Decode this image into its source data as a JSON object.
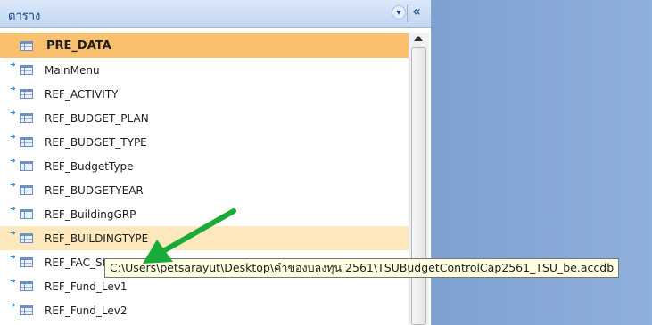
{
  "panel": {
    "title": "ตาราง",
    "dropdown_icon": "chevron-down-icon",
    "collapse_label": "«"
  },
  "tables": [
    {
      "name": "PRE_DATA",
      "state": "selected"
    },
    {
      "name": "MainMenu",
      "state": "normal"
    },
    {
      "name": "REF_ACTIVITY",
      "state": "normal"
    },
    {
      "name": "REF_BUDGET_PLAN",
      "state": "normal"
    },
    {
      "name": "REF_BUDGET_TYPE",
      "state": "normal"
    },
    {
      "name": "REF_BudgetType",
      "state": "normal"
    },
    {
      "name": "REF_BUDGETYEAR",
      "state": "normal"
    },
    {
      "name": "REF_BuildingGRP",
      "state": "normal"
    },
    {
      "name": "REF_BUILDINGTYPE",
      "state": "hover"
    },
    {
      "name": "REF_FAC_St",
      "state": "normal"
    },
    {
      "name": "REF_Fund_Lev1",
      "state": "normal"
    },
    {
      "name": "REF_Fund_Lev2",
      "state": "normal"
    }
  ],
  "tooltip": {
    "text": "C:\\Users\\petsarayut\\Desktop\\คำของบลงทุน 2561\\TSUBudgetControlCap2561_TSU_be.accdb"
  },
  "colors": {
    "selected": "#fbc06d",
    "hover": "#fde7bd",
    "workspace": "#87a8d6",
    "annotation_arrow": "#1aaa3a"
  }
}
